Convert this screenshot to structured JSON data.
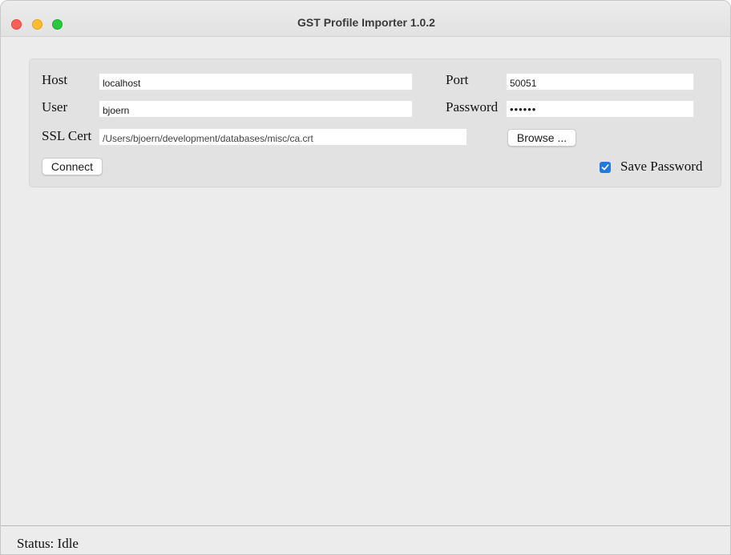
{
  "window": {
    "title": "GST Profile Importer 1.0.2"
  },
  "form": {
    "host_label": "Host",
    "host_value": "localhost",
    "port_label": "Port",
    "port_value": "50051",
    "user_label": "User",
    "user_value": "bjoern",
    "password_label": "Password",
    "password_value": "••••••",
    "ssl_label": "SSL Cert",
    "ssl_value": "/Users/bjoern/development/databases/misc/ca.crt",
    "browse_label": "Browse ...",
    "connect_label": "Connect",
    "save_password_label": "Save Password",
    "save_password_checked": true
  },
  "status": {
    "text": "Status: Idle"
  },
  "colors": {
    "accent": "#1f7ae0",
    "close": "#fe5f57",
    "minimize": "#febc2e",
    "maximize": "#28c840"
  }
}
